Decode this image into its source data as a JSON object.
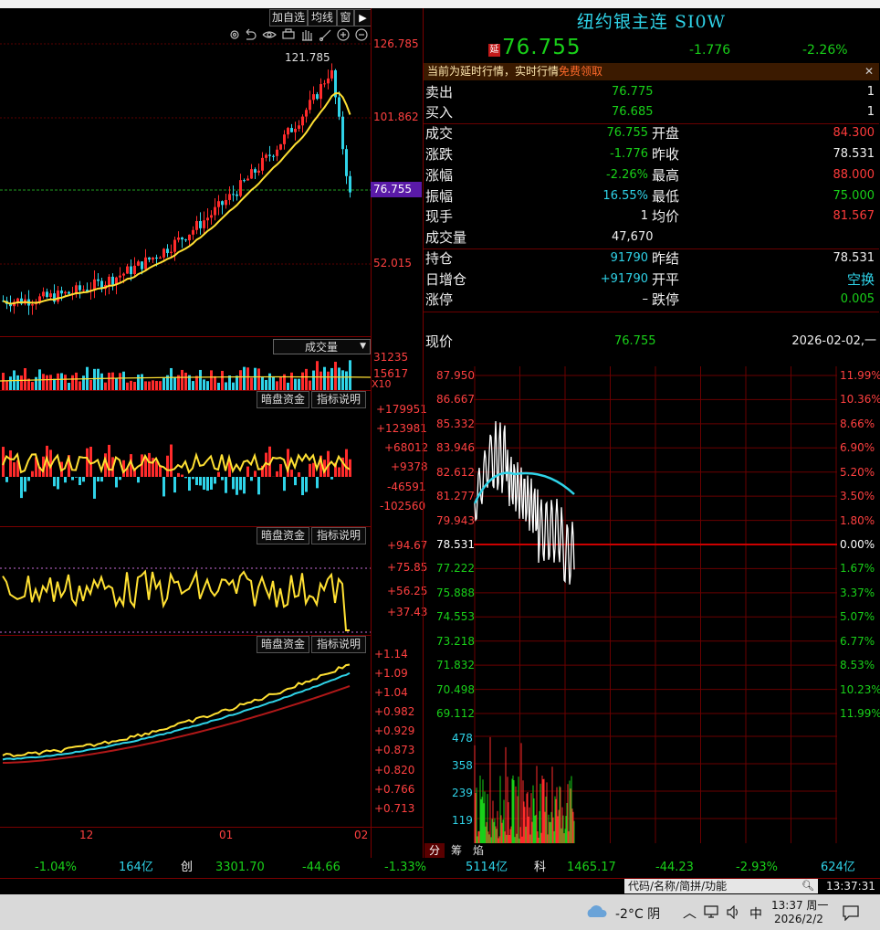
{
  "toolbar": {
    "buttons": [
      "加自选",
      "均线",
      "窗"
    ],
    "menu_arrow": "▶"
  },
  "kline": {
    "price_axis": [
      "126.785",
      "101.862",
      "76.755",
      "52.015"
    ],
    "peak_label": "121.785",
    "current_tag": "76.755",
    "colors": {
      "up": "#ff2b2b",
      "down": "#2fd3e8",
      "ma": "#ffe033"
    }
  },
  "volume_panel": {
    "selector": "成交量",
    "axis": [
      "31235",
      "15617",
      "X10"
    ]
  },
  "indicator1": {
    "btn_fund": "暗盘资金",
    "btn_explain": "指标说明",
    "axis": [
      "+179951",
      "+123981",
      "+68012",
      "+9378",
      "-46591",
      "-102560"
    ]
  },
  "indicator2": {
    "btn_fund": "暗盘资金",
    "btn_explain": "指标说明",
    "axis": [
      "+94.67",
      "+75.85",
      "+56.25",
      "+37.43"
    ]
  },
  "indicator3": {
    "btn_fund": "暗盘资金",
    "btn_explain": "指标说明",
    "axis": [
      "+1.14",
      "+1.09",
      "+1.04",
      "+0.982",
      "+0.929",
      "+0.873",
      "+0.820",
      "+0.766",
      "+0.713"
    ]
  },
  "date_axis": [
    "12",
    "01",
    "02"
  ],
  "quote": {
    "title": "纽约银主连 SI0W",
    "delay_badge": "延",
    "price": "76.755",
    "change": "-1.776",
    "change_pct": "-2.26%",
    "notice_text": "当前为延时行情，实时行情",
    "notice_link": "免费领取",
    "notice_close": "✕",
    "ask_label": "卖出",
    "ask_price": "76.775",
    "ask_vol": "1",
    "bid_label": "买入",
    "bid_price": "76.685",
    "bid_vol": "1",
    "rows": [
      {
        "l1": "成交",
        "v1": "76.755",
        "l2": "开盘",
        "v2": "84.300"
      },
      {
        "l1": "涨跌",
        "v1": "-1.776",
        "l2": "昨收",
        "v2": "78.531"
      },
      {
        "l1": "涨幅",
        "v1": "-2.26%",
        "l2": "最高",
        "v2": "88.000"
      },
      {
        "l1": "振幅",
        "v1": "16.55%",
        "l2": "最低",
        "v2": "75.000"
      },
      {
        "l1": "现手",
        "v1": "1",
        "l2": "均价",
        "v2": "81.567"
      }
    ],
    "volume_label": "成交量",
    "volume_value": "47,670",
    "oi_rows": [
      {
        "l1": "持仓",
        "v1": "91790",
        "l2": "昨结",
        "v2": "78.531"
      },
      {
        "l1": "日增仓",
        "v1": "+91790",
        "l2": "开平",
        "v2": "空换"
      },
      {
        "l1": "涨停",
        "v1": "–",
        "l2": "跌停",
        "v2": "0.005"
      }
    ],
    "now_label": "现价",
    "now_value": "76.755",
    "now_date": "2026-02-02,一"
  },
  "intraday": {
    "price_axis": [
      "87.950",
      "86.667",
      "85.332",
      "83.946",
      "82.612",
      "81.277",
      "79.943",
      "78.531",
      "77.222",
      "75.888",
      "74.553",
      "73.218",
      "71.832",
      "70.498",
      "69.112"
    ],
    "pct_axis": [
      "11.99%",
      "10.36%",
      "8.66%",
      "6.90%",
      "5.20%",
      "3.50%",
      "1.80%",
      "0.00%",
      "1.67%",
      "3.37%",
      "5.07%",
      "6.77%",
      "8.53%",
      "10.23%",
      "11.99%"
    ],
    "vol_axis": [
      "478",
      "358",
      "239",
      "119"
    ],
    "tabs": [
      "分",
      "筹",
      "焰"
    ]
  },
  "ticker": {
    "items": [
      "-1.04%",
      "164亿",
      "创",
      "3301.70",
      "-44.66",
      "-1.33%",
      "5114亿",
      "科",
      "1465.17",
      "-44.23",
      "-2.93%",
      "624亿"
    ]
  },
  "statusbar": {
    "search_placeholder": "代码/名称/简拼/功能",
    "clock": "13:37:31"
  },
  "taskbar": {
    "weather": "-2°C 阴",
    "ime": "中",
    "time": "13:37 周一",
    "date": "2026/2/2"
  }
}
